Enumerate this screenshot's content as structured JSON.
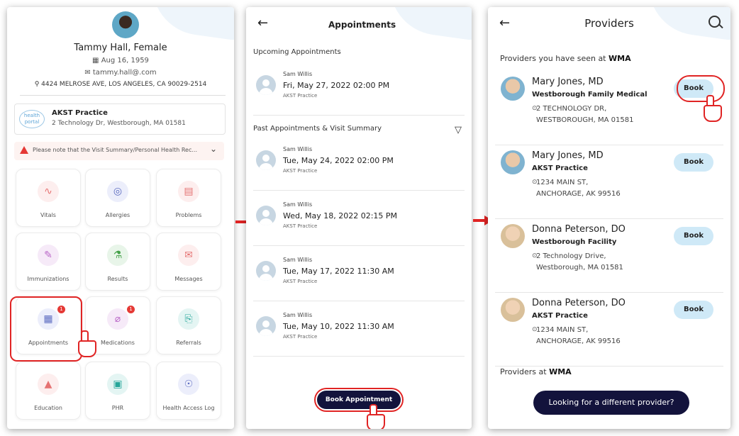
{
  "profile": {
    "name": "Tammy Hall, Female",
    "dob": "Aug 16, 1959",
    "email": "tammy.hall@.com",
    "address": "4424 MELROSE AVE, LOS ANGELES, CA 90029-2514"
  },
  "practice": {
    "logo_text": "health portal",
    "name": "AKST Practice",
    "address": "2 Technology Dr, Westborough, MA 01581"
  },
  "notice": "Please note that the Visit Summary/Personal Health Rec...",
  "tiles": [
    {
      "label": "Vitals",
      "icon": "vitals-icon",
      "glyph": "∿",
      "color": "#e57373",
      "bg": "#fdeeee"
    },
    {
      "label": "Allergies",
      "icon": "allergies-icon",
      "glyph": "◎",
      "color": "#5c6bc0",
      "bg": "#eceefb"
    },
    {
      "label": "Problems",
      "icon": "problems-icon",
      "glyph": "▤",
      "color": "#e57373",
      "bg": "#fdeeee"
    },
    {
      "label": "Immunizations",
      "icon": "syringe-icon",
      "glyph": "✎",
      "color": "#ba68c8",
      "bg": "#f6eaf8"
    },
    {
      "label": "Results",
      "icon": "flask-icon",
      "glyph": "⚗",
      "color": "#43a047",
      "bg": "#e8f5e9"
    },
    {
      "label": "Messages",
      "icon": "envelope-icon",
      "glyph": "✉",
      "color": "#e57373",
      "bg": "#fdeeee"
    },
    {
      "label": "Appointments",
      "icon": "calendar-icon",
      "glyph": "▦",
      "color": "#5c6bc0",
      "bg": "#eceefb",
      "badge": "1"
    },
    {
      "label": "Medications",
      "icon": "pill-icon",
      "glyph": "⌀",
      "color": "#ba68c8",
      "bg": "#f6eaf8",
      "badge": "1"
    },
    {
      "label": "Referrals",
      "icon": "referral-icon",
      "glyph": "⎘",
      "color": "#26a69a",
      "bg": "#e4f5f3"
    },
    {
      "label": "Education",
      "icon": "graduation-cap-icon",
      "glyph": "▲",
      "color": "#e57373",
      "bg": "#fdeeee"
    },
    {
      "label": "PHR",
      "icon": "phr-icon",
      "glyph": "▣",
      "color": "#26a69a",
      "bg": "#e4f5f3"
    },
    {
      "label": "Health Access Log",
      "icon": "access-log-icon",
      "glyph": "☉",
      "color": "#5c6bc0",
      "bg": "#eceefb"
    }
  ],
  "appointments_screen": {
    "title": "Appointments",
    "upcoming_header": "Upcoming Appointments",
    "past_header": "Past Appointments & Visit Summary",
    "upcoming": [
      {
        "provider": "Sam Willis",
        "datetime": "Fri, May 27, 2022 02:00 PM",
        "location": "AKST Practice"
      }
    ],
    "past": [
      {
        "provider": "Sam Willis",
        "datetime": "Tue, May 24, 2022 02:00 PM",
        "location": "AKST Practice"
      },
      {
        "provider": "Sam Willis",
        "datetime": "Wed, May 18, 2022 02:15 PM",
        "location": "AKST Practice"
      },
      {
        "provider": "Sam Willis",
        "datetime": "Tue, May 17, 2022 11:30 AM",
        "location": "AKST Practice"
      },
      {
        "provider": "Sam Willis",
        "datetime": "Tue, May 10, 2022 11:30 AM",
        "location": "AKST Practice"
      }
    ],
    "book_label": "Book Appointment"
  },
  "providers_screen": {
    "title": "Providers",
    "seen_prefix": "Providers you have seen at ",
    "org": "WMA",
    "at_prefix": "Providers at ",
    "providers": [
      {
        "name": "Mary Jones, MD",
        "facility": "Westborough Family Medical",
        "addr1": "2 TECHNOLOGY DR,",
        "addr2": "WESTBOROUGH, MA 01581",
        "book": "Book"
      },
      {
        "name": "Mary Jones, MD",
        "facility": "AKST Practice",
        "addr1": "1234 MAIN ST,",
        "addr2": "ANCHORAGE, AK 99516",
        "book": "Book"
      },
      {
        "name": "Donna Peterson, DO",
        "facility": "Westborough Facility",
        "addr1": "2 Technology Drive,",
        "addr2": "Westborough, MA 01581",
        "book": "Book"
      },
      {
        "name": "Donna Peterson, DO",
        "facility": "AKST Practice",
        "addr1": "1234 MAIN ST,",
        "addr2": "ANCHORAGE, AK 99516",
        "book": "Book"
      }
    ],
    "different_label": "Looking for a different provider?"
  },
  "colors": {
    "accent_red": "#e02424",
    "navy": "#13133c",
    "book_bg": "#cfe9f7"
  }
}
